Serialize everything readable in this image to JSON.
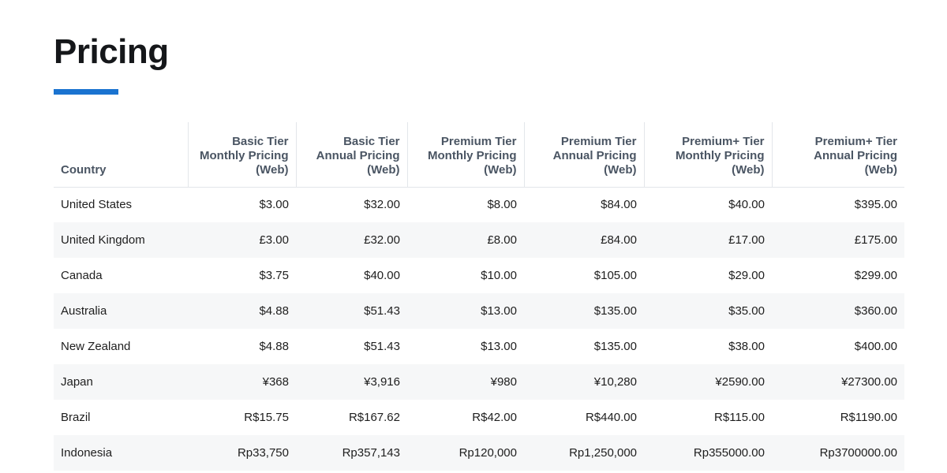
{
  "page": {
    "title": "Pricing",
    "accent_color": "#1a73d0"
  },
  "table": {
    "headers": [
      "Country",
      "Basic Tier Monthly Pricing (Web)",
      "Basic Tier Annual Pricing (Web)",
      "Premium Tier Monthly Pricing (Web)",
      "Premium Tier Annual Pricing (Web)",
      "Premium+ Tier Monthly Pricing (Web)",
      "Premium+ Tier Annual Pricing (Web)"
    ],
    "rows": [
      [
        "United States",
        "$3.00",
        "$32.00",
        "$8.00",
        "$84.00",
        "$40.00",
        "$395.00"
      ],
      [
        "United Kingdom",
        "£3.00",
        "£32.00",
        "£8.00",
        "£84.00",
        "£17.00",
        "£175.00"
      ],
      [
        "Canada",
        "$3.75",
        "$40.00",
        "$10.00",
        "$105.00",
        "$29.00",
        "$299.00"
      ],
      [
        "Australia",
        "$4.88",
        "$51.43",
        "$13.00",
        "$135.00",
        "$35.00",
        "$360.00"
      ],
      [
        "New Zealand",
        "$4.88",
        "$51.43",
        "$13.00",
        "$135.00",
        "$38.00",
        "$400.00"
      ],
      [
        "Japan",
        "¥368",
        "¥3,916",
        "¥980",
        "¥10,280",
        "¥2590.00",
        "¥27300.00"
      ],
      [
        "Brazil",
        "R$15.75",
        "R$167.62",
        "R$42.00",
        "R$440.00",
        "R$115.00",
        "R$1190.00"
      ],
      [
        "Indonesia",
        "Rp33,750",
        "Rp357,143",
        "Rp120,000",
        "Rp1,250,000",
        "Rp355000.00",
        "Rp3700000.00"
      ]
    ]
  }
}
